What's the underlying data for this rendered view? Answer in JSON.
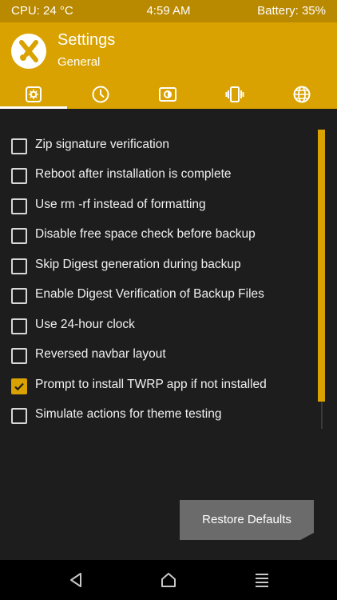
{
  "status_bar": {
    "cpu": "CPU: 24 °C",
    "time": "4:59 AM",
    "battery": "Battery: 35%"
  },
  "header": {
    "title": "Settings",
    "subtitle": "General",
    "logo_icon": "twrp-logo-icon"
  },
  "tabs": [
    {
      "name": "general",
      "icon": "gear-icon",
      "active": true
    },
    {
      "name": "time",
      "icon": "clock-icon",
      "active": false
    },
    {
      "name": "screen",
      "icon": "brightness-icon",
      "active": false
    },
    {
      "name": "vibration",
      "icon": "vibrate-icon",
      "active": false
    },
    {
      "name": "language",
      "icon": "globe-icon",
      "active": false
    }
  ],
  "options": [
    {
      "label": "Zip signature verification",
      "checked": false
    },
    {
      "label": "Reboot after installation is complete",
      "checked": false
    },
    {
      "label": "Use rm -rf instead of formatting",
      "checked": false
    },
    {
      "label": "Disable free space check before backup",
      "checked": false
    },
    {
      "label": "Skip Digest generation during backup",
      "checked": false
    },
    {
      "label": "Enable Digest Verification of Backup Files",
      "checked": false
    },
    {
      "label": "Use 24-hour clock",
      "checked": false
    },
    {
      "label": "Reversed navbar layout",
      "checked": false
    },
    {
      "label": "Prompt to install TWRP app if not installed",
      "checked": true
    },
    {
      "label": "Simulate actions for theme testing",
      "checked": false
    }
  ],
  "restore_defaults_label": "Restore Defaults",
  "navbar": {
    "back_icon": "back-triangle-icon",
    "home_icon": "home-icon",
    "menu_icon": "menu-icon"
  },
  "colors": {
    "accent": "#d9a200",
    "status_bar": "#b98900",
    "background": "#1d1d1d"
  }
}
